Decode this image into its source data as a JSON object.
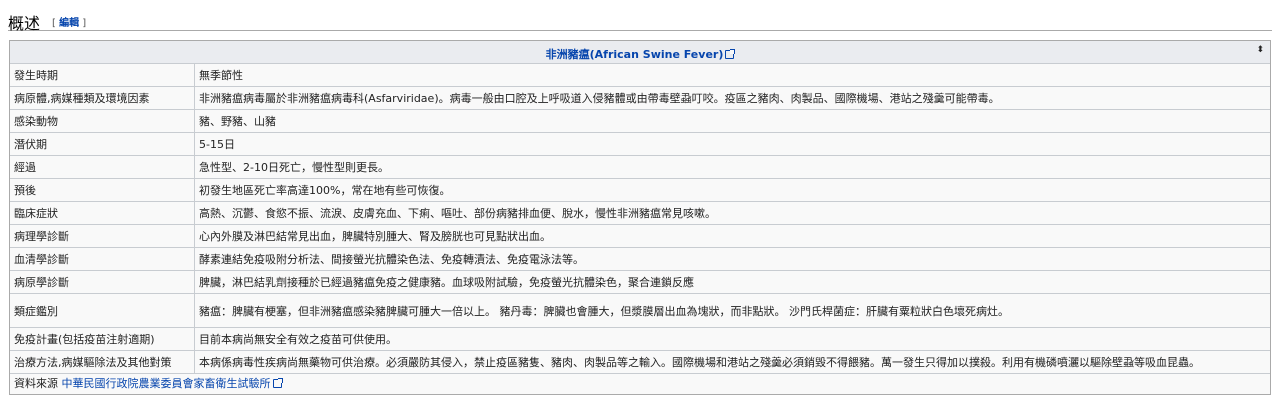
{
  "section": {
    "title": "概述",
    "edit_open": "[",
    "edit_label": "編輯",
    "edit_close": "]"
  },
  "infobox": {
    "title": "非洲豬瘟(African Swine Fever)",
    "rows": [
      {
        "key": "發生時期",
        "value": "無季節性"
      },
      {
        "key": "病原體,病媒種類及環境因素",
        "value": "非洲豬瘟病毒屬於非洲豬瘟病毒科(Asfarviridae)。病毒一般由口腔及上呼吸道入侵豬體或由帶毒壁蝨叮咬。疫區之豬肉、肉製品、國際機場、港站之殘羹可能帶毒。"
      },
      {
        "key": "感染動物",
        "value": "豬、野豬、山豬"
      },
      {
        "key": "潛伏期",
        "value": "5-15日"
      },
      {
        "key": "經過",
        "value": "急性型、2-10日死亡，慢性型則更長。"
      },
      {
        "key": "預後",
        "value": "初發生地區死亡率高達100%，常在地有些可恢復。"
      },
      {
        "key": "臨床症狀",
        "value": "高熱、沉鬱、食慾不振、流淚、皮膚充血、下痢、嘔吐、部份病豬排血便、脫水，慢性非洲豬瘟常見咳嗽。"
      },
      {
        "key": "病理學診斷",
        "value": "心內外膜及淋巴結常見出血，脾臟特別腫大、腎及膀胱也可見點狀出血。"
      },
      {
        "key": "血清學診斷",
        "value": "酵素連結免疫吸附分析法、間接螢光抗體染色法、免疫轉漬法、免疫電泳法等。"
      },
      {
        "key": "病原學診斷",
        "value": "脾臟，淋巴結乳劑接種於已經過豬瘟免疫之健康豬。血球吸附試驗，免疫螢光抗體染色，聚合連鎖反應"
      },
      {
        "key": "類症鑑別",
        "value": "豬瘟：脾臟有梗塞，但非洲豬瘟感染豬脾臟可腫大一倍以上。 豬丹毒：脾臟也會腫大，但漿膜層出血為塊狀，而非點狀。 沙門氏桿菌症：肝臟有粟粒狀白色壞死病灶。",
        "tall": true
      },
      {
        "key": "免疫計畫(包括疫苗注射適期)",
        "value": "目前本病尚無安全有效之疫苗可供使用。"
      },
      {
        "key": "治療方法,病媒驅除法及其他對策",
        "value": "本病係病毒性疾病尚無藥物可供治療。必須嚴防其侵入，禁止疫區豬隻、豬肉、肉製品等之輸入。國際機場和港站之殘羹必須銷毀不得餵豬。萬一發生只得加以撲殺。利用有機磷噴灑以驅除壁蝨等吸血昆蟲。"
      }
    ],
    "source_label": "資料來源",
    "source_link": "中華民國行政院農業委員會家畜衛生試驗所",
    "sort_glyph": "⬍"
  }
}
